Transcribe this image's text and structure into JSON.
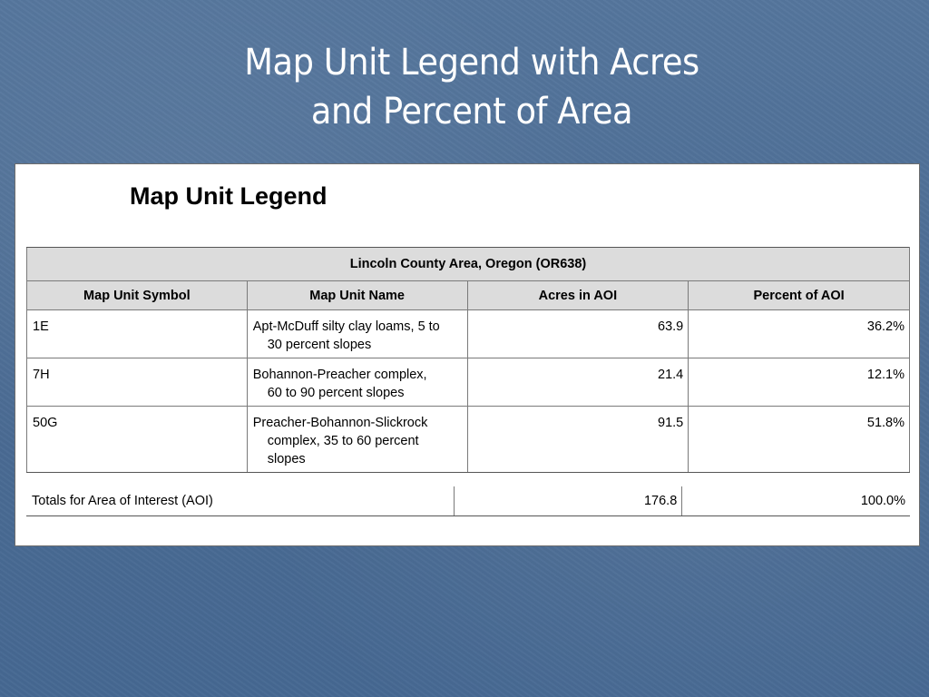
{
  "slide": {
    "title_line1": "Map Unit Legend with Acres",
    "title_line2": "and Percent of Area"
  },
  "legend": {
    "heading": "Map Unit Legend",
    "area_name": "Lincoln County Area, Oregon (OR638)",
    "columns": [
      "Map Unit Symbol",
      "Map Unit Name",
      "Acres in AOI",
      "Percent of AOI"
    ],
    "rows": [
      {
        "symbol": "1E",
        "name_line1": "Apt-McDuff silty clay loams, 5 to",
        "name_line2": "30 percent slopes",
        "name_line3": "",
        "acres": "63.9",
        "percent": "36.2%"
      },
      {
        "symbol": "7H",
        "name_line1": "Bohannon-Preacher complex,",
        "name_line2": "60 to 90 percent slopes",
        "name_line3": "",
        "acres": "21.4",
        "percent": "12.1%"
      },
      {
        "symbol": "50G",
        "name_line1": "Preacher-Bohannon-Slickrock",
        "name_line2": "complex, 35 to 60 percent",
        "name_line3": "slopes",
        "acres": "91.5",
        "percent": "51.8%"
      }
    ],
    "totals": {
      "label": "Totals for Area of Interest (AOI)",
      "acres": "176.8",
      "percent": "100.0%"
    }
  },
  "colors": {
    "background": "#4f6f96",
    "header_fill": "#dcdcdc",
    "title_text": "#ffffff"
  }
}
